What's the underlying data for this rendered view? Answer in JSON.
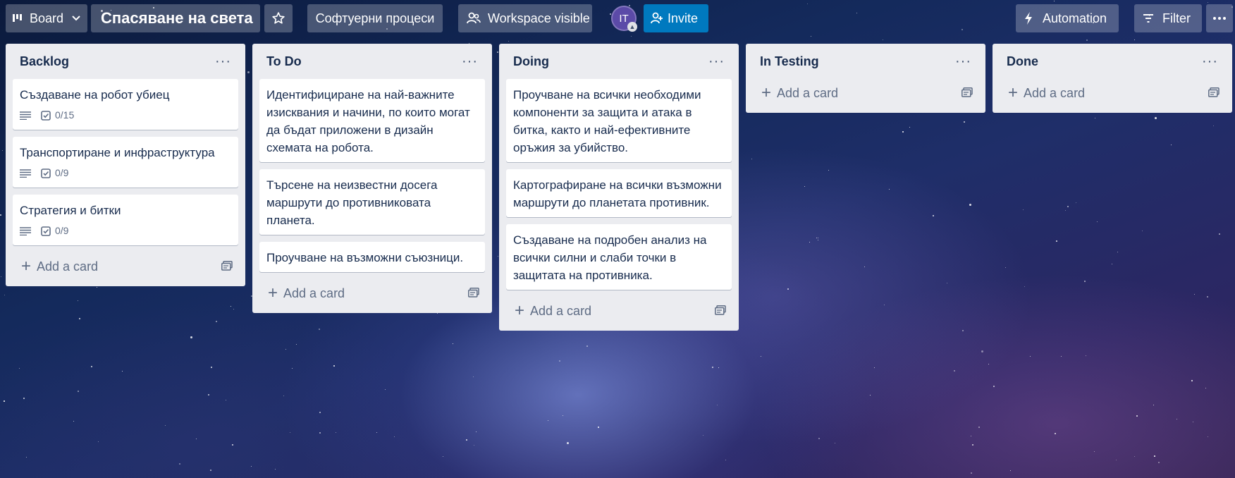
{
  "header": {
    "view_switcher": "Board",
    "board_title": "Спасяване на света",
    "workspace": "Софтуерни процеси",
    "visibility": "Workspace visible",
    "avatar_initials": "IT",
    "invite": "Invite",
    "automation": "Automation",
    "filter": "Filter"
  },
  "lists": [
    {
      "title": "Backlog",
      "cards": [
        {
          "title": "Създаване на робот убиец",
          "checklist": "0/15"
        },
        {
          "title": "Транспортиране и инфраструктура",
          "checklist": "0/9"
        },
        {
          "title": "Стратегия и битки",
          "checklist": "0/9"
        }
      ],
      "add_label": "Add a card"
    },
    {
      "title": "To Do",
      "cards": [
        {
          "title": "Идентифициране на най-важните изисквания и начини, по които могат да бъдат приложени в дизайн схемата на робота."
        },
        {
          "title": "Търсене на неизвестни досега маршрути до противниковата планета."
        },
        {
          "title": "Проучване на възможни съюзници."
        }
      ],
      "add_label": "Add a card"
    },
    {
      "title": "Doing",
      "cards": [
        {
          "title": "Проучване на всички необходими компоненти за защита и атака в битка, както и най-ефективните оръжия за убийство."
        },
        {
          "title": "Картографиране на всички възможни маршрути до планетата противник."
        },
        {
          "title": "Създаване на подробен анализ на всички силни и слаби точки в защитата на противника."
        }
      ],
      "add_label": "Add a card"
    },
    {
      "title": "In Testing",
      "cards": [],
      "add_label": "Add a card"
    },
    {
      "title": "Done",
      "cards": [],
      "add_label": "Add a card"
    }
  ],
  "icons": {
    "board": "board-icon",
    "chevron": "chevron-down-icon",
    "star": "star-icon",
    "visibility": "users-icon",
    "invite": "add-user-icon",
    "automation": "lightning-icon",
    "filter": "filter-icon",
    "more": "more-icon",
    "description": "description-icon",
    "checklist": "checklist-icon",
    "template": "template-icon"
  }
}
